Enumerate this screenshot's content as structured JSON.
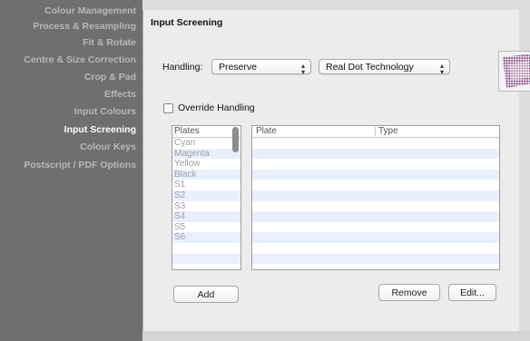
{
  "sidebar": {
    "items": [
      {
        "label": "Colour Management",
        "active": false
      },
      {
        "label": "Process & Resampling",
        "active": false
      },
      {
        "label": "Fit & Rotate",
        "active": false
      },
      {
        "label": "Centre & Size Correction",
        "active": false
      },
      {
        "label": "Crop & Pad",
        "active": false
      },
      {
        "label": "Effects",
        "active": false
      },
      {
        "label": "Input Colours",
        "active": false
      },
      {
        "label": "Input Screening",
        "active": true
      },
      {
        "label": "Colour Keys",
        "active": false
      },
      {
        "label": "Postscript / PDF Options",
        "active": false
      }
    ]
  },
  "panel": {
    "title": "Input Screening",
    "handling_label": "Handling:",
    "handling_value": "Preserve",
    "technology_value": "Real Dot Technology",
    "override_label": "Override Handling",
    "override_checked": false
  },
  "plates_list": {
    "header": "Plates",
    "items": [
      "Cyan",
      "Magenta",
      "Yellow",
      "Black",
      "S1",
      "S2",
      "S3",
      "S4",
      "S5",
      "S6"
    ]
  },
  "mapping_table": {
    "columns": [
      "Plate",
      "Type"
    ],
    "rows": []
  },
  "buttons": {
    "add": "Add",
    "remove": "Remove",
    "edit": "Edit..."
  },
  "icons": {
    "screen_preview": "halftone-screen-icon",
    "popup_arrows": "updown-chevron-icon"
  }
}
